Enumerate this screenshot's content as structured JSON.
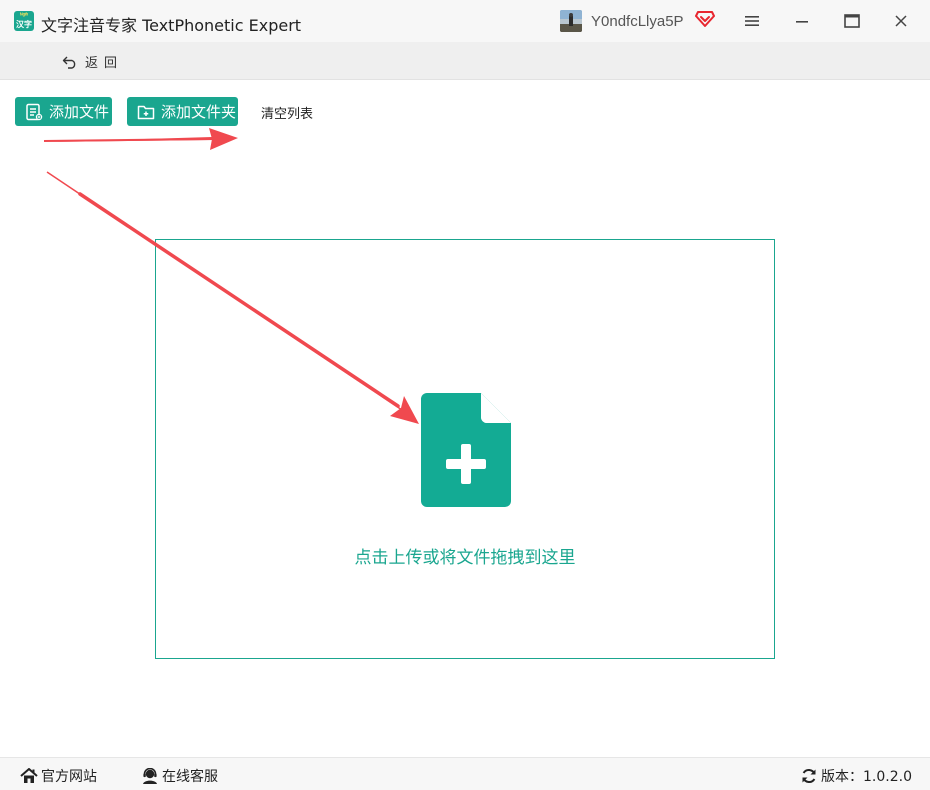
{
  "window": {
    "title": "文字注音专家 TextPhonetic Expert",
    "logo_top": "ᴺᵍᶦʰ",
    "logo_bottom": "汉字",
    "username": "Y0ndfcLlya5P"
  },
  "icons": {
    "logo": "app-logo-icon",
    "vip": "vip-diamond-icon",
    "menu": "hamburger-menu-icon",
    "minimize": "minimize-icon",
    "maximize": "maximize-icon",
    "close": "close-icon",
    "back": "back-arrow-icon",
    "add_file": "file-list-icon",
    "add_folder": "folder-plus-icon",
    "upload": "file-plus-icon",
    "home": "home-icon",
    "service": "customer-service-icon",
    "refresh": "refresh-icon"
  },
  "nav": {
    "back_label": "返回"
  },
  "toolbar": {
    "add_file_label": "添加文件",
    "add_folder_label": "添加文件夹",
    "clear_list_label": "清空列表"
  },
  "dropzone": {
    "hint": "点击上传或将文件拖拽到这里"
  },
  "footer": {
    "official_site": "官方网站",
    "online_service": "在线客服",
    "version_label": "版本：1.0.2.0"
  },
  "colors": {
    "accent": "#1aa68f",
    "annotation_arrow": "#f0494f",
    "vip": "#e8262f"
  }
}
